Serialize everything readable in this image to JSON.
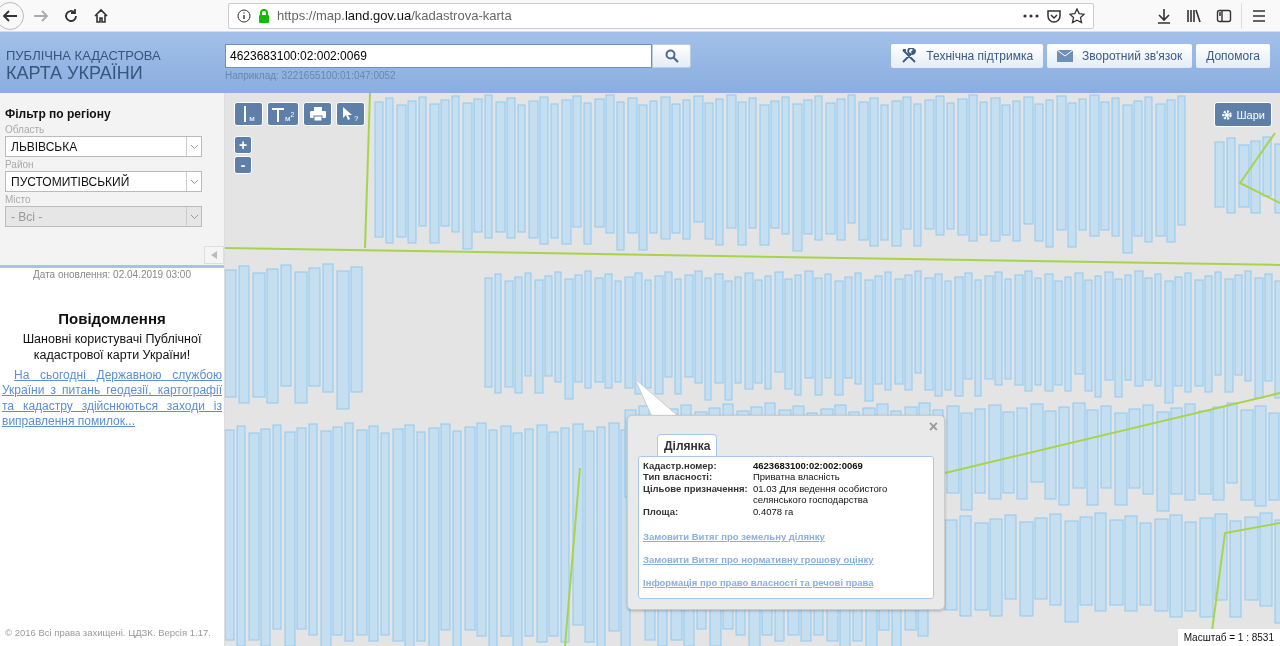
{
  "browser": {
    "url": "https://map.**land.gov.ua**/kadastrova-karta",
    "back_disabled": false,
    "forward_disabled": true
  },
  "header": {
    "title_line_1": "ПУБЛІЧНА КАДАСТРОВА",
    "title_line_2": "КАРТА УКРАЇНИ",
    "search": {
      "value": "4623683100:02:002:0069",
      "hint": "Наприклад: 3221655100:01:047:0052"
    },
    "buttons": [
      {
        "kind": "support",
        "label": "Технічна підтримка"
      },
      {
        "kind": "feedback",
        "label": "Зворотний зв'язок"
      },
      {
        "kind": "help",
        "label": "Допомога"
      }
    ]
  },
  "sidebar": {
    "filter_title": "Фільтр по регіону",
    "selects": [
      {
        "label": "Область",
        "value": "ЛЬВІВСЬКА",
        "disabled": false
      },
      {
        "label": "Район",
        "value": "ПУСТОМИТІВСЬКИЙ",
        "disabled": false
      },
      {
        "label": "Місто",
        "value": "- Всі -",
        "disabled": true
      }
    ],
    "updated": "Дата оновлення: 02.04.2019 03:00",
    "notice_title": "Повідомлення",
    "notice_greeting": "Шановні користувачі Публічної кадастрової карти України!",
    "notice_link": "На сьогодні Державною службою України з питань геодезії, картографії та кадастру здійснюються заходи із виправлення помилок...",
    "footer": "© 2016 Всі права захищені. ЦДЗК. Версія 1.17."
  },
  "map": {
    "tools": [
      {
        "kind": "distance",
        "label": "м"
      },
      {
        "kind": "area",
        "label": "м$^{2}$"
      },
      {
        "kind": "print"
      },
      {
        "kind": "info",
        "label": "?"
      }
    ],
    "zoom_in": "+",
    "zoom_out": "-",
    "layers_button": "Шари",
    "popup": {
      "tab": "Ділянка",
      "close": "×",
      "rows": [
        {
          "label": "Кадастр.номер:",
          "value": "4623683100:02:002:0069",
          "bold": true
        },
        {
          "label": "Тип власності:",
          "value": "Приватна власність",
          "bold": false
        },
        {
          "label": "Цільове призначення:",
          "value": "01.03 Для ведення особистого селянського господарства",
          "bold": false
        },
        {
          "label": "Площа:",
          "value": "0.4078 га",
          "bold": false
        }
      ],
      "links": [
        "Замовити Витяг про земельну ділянку",
        "Замовити Витяг про нормативну грошову оцінку",
        "Інформація про право власності та речові права"
      ]
    },
    "scale": "Масштаб = 1 : 8531"
  }
}
